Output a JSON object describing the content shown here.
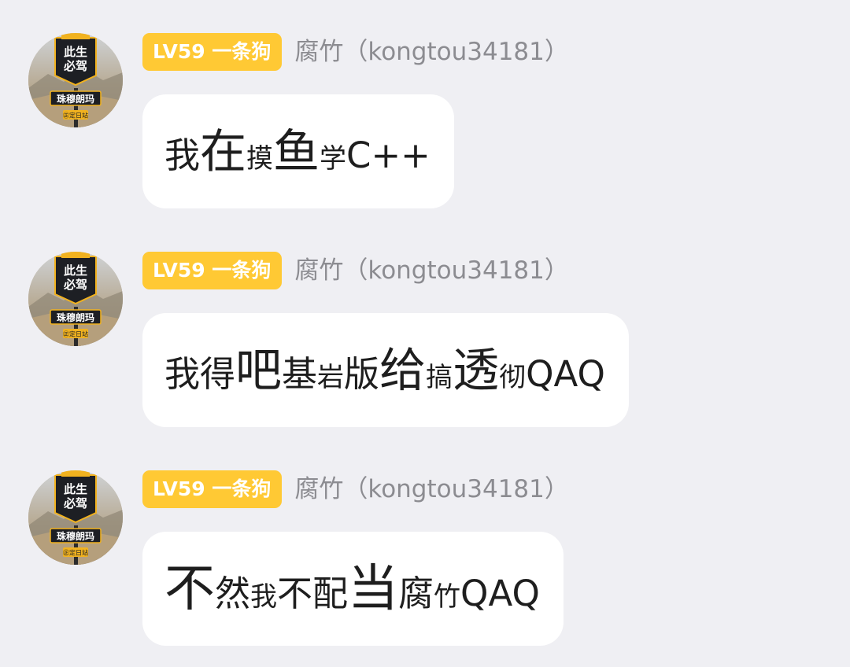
{
  "colors": {
    "background": "#efeff3",
    "badge": "#ffc934",
    "nickname": "#8c8c91",
    "bubble": "#ffffff",
    "text": "#1e1e1e"
  },
  "messages": [
    {
      "avatar": {
        "icon": "avatar-image",
        "sign_top": "此生\n必驾",
        "sign_bottom": "珠穆朗玛",
        "sign_tag": "㊣定日站"
      },
      "badge": "LV59 一条狗",
      "nickname": "腐竹（kongtou34181）",
      "segments": [
        {
          "text": "我",
          "size": "m"
        },
        {
          "text": "在",
          "size": "l"
        },
        {
          "text": "摸",
          "size": "s"
        },
        {
          "text": "鱼",
          "size": "l"
        },
        {
          "text": "学",
          "size": "s"
        },
        {
          "text": "C++",
          "size": "m"
        }
      ]
    },
    {
      "avatar": {
        "icon": "avatar-image",
        "sign_top": "此生\n必驾",
        "sign_bottom": "珠穆朗玛",
        "sign_tag": "㊣定日站"
      },
      "badge": "LV59 一条狗",
      "nickname": "腐竹（kongtou34181）",
      "segments": [
        {
          "text": "我得",
          "size": "m"
        },
        {
          "text": "吧",
          "size": "l"
        },
        {
          "text": "基",
          "size": "m"
        },
        {
          "text": "岩",
          "size": "s"
        },
        {
          "text": "版",
          "size": "m"
        },
        {
          "text": "给",
          "size": "l"
        },
        {
          "text": "搞",
          "size": "s"
        },
        {
          "text": "透",
          "size": "l"
        },
        {
          "text": "彻",
          "size": "s"
        },
        {
          "text": "QAQ",
          "size": "m"
        }
      ]
    },
    {
      "avatar": {
        "icon": "avatar-image",
        "sign_top": "此生\n必驾",
        "sign_bottom": "珠穆朗玛",
        "sign_tag": "㊣定日站"
      },
      "badge": "LV59 一条狗",
      "nickname": "腐竹（kongtou34181）",
      "segments": [
        {
          "text": "不",
          "size": "xl"
        },
        {
          "text": "然",
          "size": "m"
        },
        {
          "text": "我",
          "size": "s"
        },
        {
          "text": "不配",
          "size": "m"
        },
        {
          "text": "当",
          "size": "xl"
        },
        {
          "text": "腐",
          "size": "m"
        },
        {
          "text": "竹",
          "size": "s"
        },
        {
          "text": "QAQ",
          "size": "m"
        }
      ]
    }
  ]
}
